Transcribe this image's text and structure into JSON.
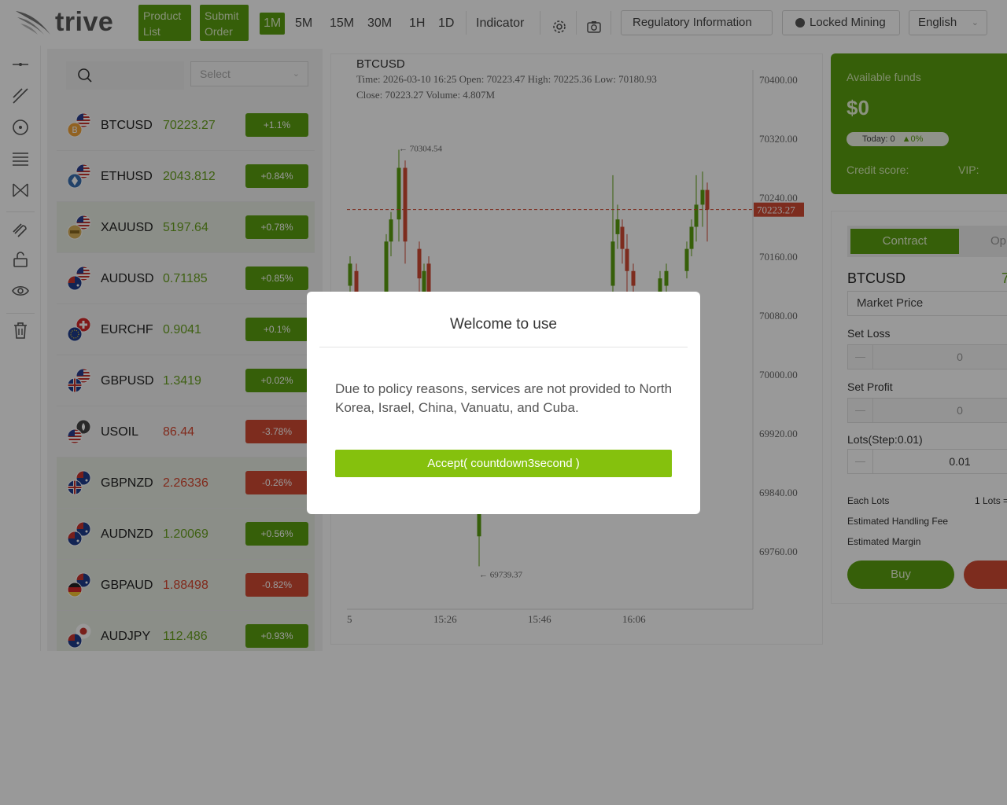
{
  "header": {
    "logo_text": "trive",
    "product_list_label": "Product List",
    "submit_order_label": "Submit Order",
    "timeframes": [
      "1M",
      "5M",
      "15M",
      "30M",
      "1H",
      "1D"
    ],
    "active_timeframe": "1M",
    "indicator_label": "Indicator",
    "regulatory_label": "Regulatory Information",
    "locked_mining_label": "Locked Mining",
    "language": "English"
  },
  "product_list": {
    "select_placeholder": "Select",
    "items": [
      {
        "symbol": "BTCUSD",
        "price": "70223.27",
        "change": "+1.1%",
        "dir": "up",
        "flag": "btc-usd",
        "highlight": false
      },
      {
        "symbol": "ETHUSD",
        "price": "2043.812",
        "change": "+0.84%",
        "dir": "up",
        "flag": "eth-usd",
        "highlight": false
      },
      {
        "symbol": "XAUUSD",
        "price": "5197.64",
        "change": "+0.78%",
        "dir": "up",
        "flag": "xau-usd",
        "highlight": true
      },
      {
        "symbol": "AUDUSD",
        "price": "0.71185",
        "change": "+0.85%",
        "dir": "up",
        "flag": "aud-usd",
        "highlight": false
      },
      {
        "symbol": "EURCHF",
        "price": "0.9041",
        "change": "+0.1%",
        "dir": "up",
        "flag": "eur-chf",
        "highlight": false
      },
      {
        "symbol": "GBPUSD",
        "price": "1.3419",
        "change": "+0.02%",
        "dir": "up",
        "flag": "gbp-usd",
        "highlight": false
      },
      {
        "symbol": "USOIL",
        "price": "86.44",
        "change": "-3.78%",
        "dir": "down",
        "flag": "usoil",
        "highlight": false
      },
      {
        "symbol": "GBPNZD",
        "price": "2.26336",
        "change": "-0.26%",
        "dir": "down",
        "flag": "gbp-nzd",
        "highlight": true
      },
      {
        "symbol": "AUDNZD",
        "price": "1.20069",
        "change": "+0.56%",
        "dir": "up",
        "flag": "aud-nzd",
        "highlight": true
      },
      {
        "symbol": "GBPAUD",
        "price": "1.88498",
        "change": "-0.82%",
        "dir": "down",
        "flag": "gbp-aud",
        "highlight": true
      },
      {
        "symbol": "AUDJPY",
        "price": "112.486",
        "change": "+0.93%",
        "dir": "up",
        "flag": "aud-jpy",
        "highlight": true
      }
    ]
  },
  "chart": {
    "symbol": "BTCUSD",
    "info_line1": "Time: 2026-03-10 16:25   Open: 70223.47   High: 70225.36   Low: 70180.93",
    "info_line2": "Close: 70223.27   Volume: 4.807M",
    "max_label": "70304.54",
    "min_label": "69739.37",
    "current_price_label": "70223.27"
  },
  "chart_data": {
    "type": "candlestick",
    "title": "BTCUSD",
    "y_ticks": [
      70400,
      70320,
      70240,
      70160,
      70080,
      70000,
      69920,
      69840,
      69760
    ],
    "y_tick_labels": [
      "70400.00",
      "70320.00",
      "70240.00",
      "70160.00",
      "70080.00",
      "70000.00",
      "69920.00",
      "69840.00",
      "69760.00"
    ],
    "ylim": [
      69700,
      70420
    ],
    "x_tick_labels": [
      "5",
      "15:26",
      "15:46",
      "16:06"
    ],
    "current_price": 70223.27,
    "high_marker": 70304.54,
    "low_marker": 69739.37,
    "up_color": "#5a9e0f",
    "down_color": "#d14a32",
    "candles": [
      {
        "o": 70120,
        "c": 70150,
        "h": 70160,
        "l": 70040
      },
      {
        "o": 70140,
        "c": 70100,
        "h": 70150,
        "l": 70050
      },
      {
        "o": 70060,
        "c": 70180,
        "h": 70190,
        "l": 70030
      },
      {
        "o": 70180,
        "c": 70210,
        "h": 70220,
        "l": 70160
      },
      {
        "o": 70210,
        "c": 70280,
        "h": 70304.54,
        "l": 70180
      },
      {
        "o": 70280,
        "c": 70180,
        "h": 70290,
        "l": 70150
      },
      {
        "o": 70170,
        "c": 70130,
        "h": 70180,
        "l": 70100
      },
      {
        "o": 70100,
        "c": 70140,
        "h": 70150,
        "l": 70080
      },
      {
        "o": 70150,
        "c": 70080,
        "h": 70160,
        "l": 70060
      },
      {
        "o": 69780,
        "c": 69830,
        "h": 69840,
        "l": 69739.37
      },
      {
        "o": 70120,
        "c": 70180,
        "h": 70270,
        "l": 70100
      },
      {
        "o": 70190,
        "c": 70210,
        "h": 70230,
        "l": 70170
      },
      {
        "o": 70200,
        "c": 70170,
        "h": 70210,
        "l": 70150
      },
      {
        "o": 70170,
        "c": 70140,
        "h": 70190,
        "l": 70110
      },
      {
        "o": 70140,
        "c": 70120,
        "h": 70150,
        "l": 70100
      },
      {
        "o": 70110,
        "c": 70130,
        "h": 70140,
        "l": 70100
      },
      {
        "o": 70120,
        "c": 70140,
        "h": 70150,
        "l": 70110
      },
      {
        "o": 70140,
        "c": 70170,
        "h": 70180,
        "l": 70130
      },
      {
        "o": 70170,
        "c": 70200,
        "h": 70210,
        "l": 70160
      },
      {
        "o": 70200,
        "c": 70230,
        "h": 70270,
        "l": 70180
      },
      {
        "o": 70230,
        "c": 70250,
        "h": 70275,
        "l": 70200
      },
      {
        "o": 70250,
        "c": 70223.27,
        "h": 70260,
        "l": 70180
      }
    ]
  },
  "funds": {
    "label": "Available funds",
    "amount": "$0",
    "today_label": "Today: 0",
    "today_pct": "0%",
    "credit_label": "Credit score:",
    "vip_label": "VIP:"
  },
  "trade": {
    "tab_contract": "Contract",
    "tab_option": "Op",
    "symbol": "BTCUSD",
    "symbol_value": "7",
    "order_type": "Market Price",
    "set_loss_label": "Set Loss",
    "set_loss_value": "0",
    "set_profit_label": "Set Profit",
    "set_profit_value": "0",
    "lots_label": "Lots(Step:0.01)",
    "lots_value": "0.01",
    "each_lots_label": "Each Lots",
    "each_lots_value": "1 Lots =",
    "handling_fee_label": "Estimated Handling Fee",
    "margin_label": "Estimated Margin",
    "buy_label": "Buy"
  },
  "modal": {
    "title": "Welcome to use",
    "body": "Due to policy reasons, services are not provided to North Korea, Israel, China, Vanuatu, and Cuba.",
    "accept_label": "Accept( countdown3second )"
  }
}
